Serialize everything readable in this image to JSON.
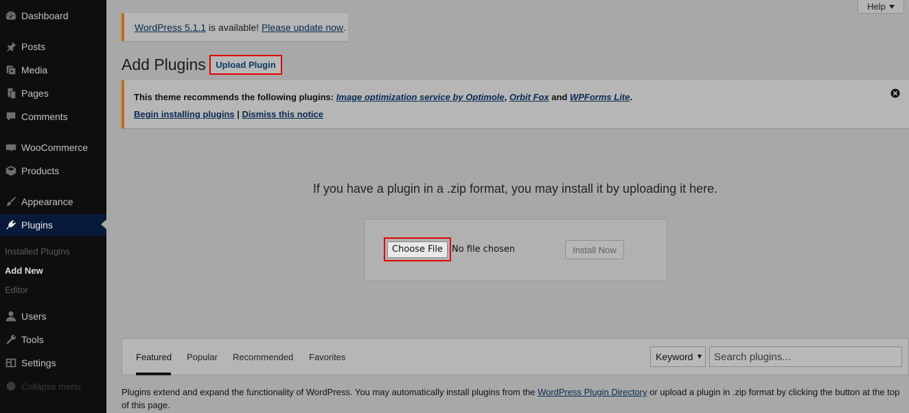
{
  "sidebar": {
    "items": [
      {
        "label": "Dashboard",
        "icon": "dashboard-icon"
      },
      {
        "label": "Posts",
        "icon": "pin-icon"
      },
      {
        "label": "Media",
        "icon": "media-icon"
      },
      {
        "label": "Pages",
        "icon": "pages-icon"
      },
      {
        "label": "Comments",
        "icon": "comments-icon"
      },
      {
        "label": "WooCommerce",
        "icon": "woocommerce-icon"
      },
      {
        "label": "Products",
        "icon": "products-icon"
      },
      {
        "label": "Appearance",
        "icon": "brush-icon"
      },
      {
        "label": "Plugins",
        "icon": "plugin-icon",
        "current": true
      },
      {
        "label": "Users",
        "icon": "users-icon"
      },
      {
        "label": "Tools",
        "icon": "wrench-icon"
      },
      {
        "label": "Settings",
        "icon": "settings-icon"
      }
    ],
    "submenu": [
      "Installed Plugins",
      "Add New",
      "Editor"
    ],
    "collapse_label": "Collapse menu"
  },
  "help_label": "Help",
  "update_notice": {
    "link1": "WordPress 5.1.1",
    "middle": " is available! ",
    "link2": "Please update now",
    "end": "."
  },
  "page_title": "Add Plugins",
  "upload_plugin_label": "Upload Plugin",
  "theme_notice": {
    "prefix": "This theme recommends the following plugins: ",
    "plugin1": "Image optimization service by Optimole",
    "sep1": ", ",
    "plugin2": "Orbit Fox",
    "sep2": " and ",
    "plugin3": "WPForms Lite",
    "end": ".",
    "action1": "Begin installing plugins",
    "sep3": " | ",
    "action2": "Dismiss this notice"
  },
  "upload_text": "If you have a plugin in a .zip format, you may install it by uploading it here.",
  "choose_file_label": "Choose File",
  "no_file_label": "No file chosen",
  "install_now_label": "Install Now",
  "tabs": [
    "Featured",
    "Popular",
    "Recommended",
    "Favorites"
  ],
  "keyword_label": "Keyword",
  "search_placeholder": "Search plugins...",
  "bottom_text": {
    "part1": "Plugins extend and expand the functionality of WordPress. You may automatically install plugins from the ",
    "link": "WordPress Plugin Directory",
    "part2": " or upload a plugin in .zip format by clicking the button at the top of this page."
  },
  "colors": {
    "sidebar_bg": "#0e0e0e",
    "current_menu_bg": "#081a3a",
    "notice_border": "#c46b12",
    "highlight_red": "#e00000",
    "link": "#072a52"
  }
}
